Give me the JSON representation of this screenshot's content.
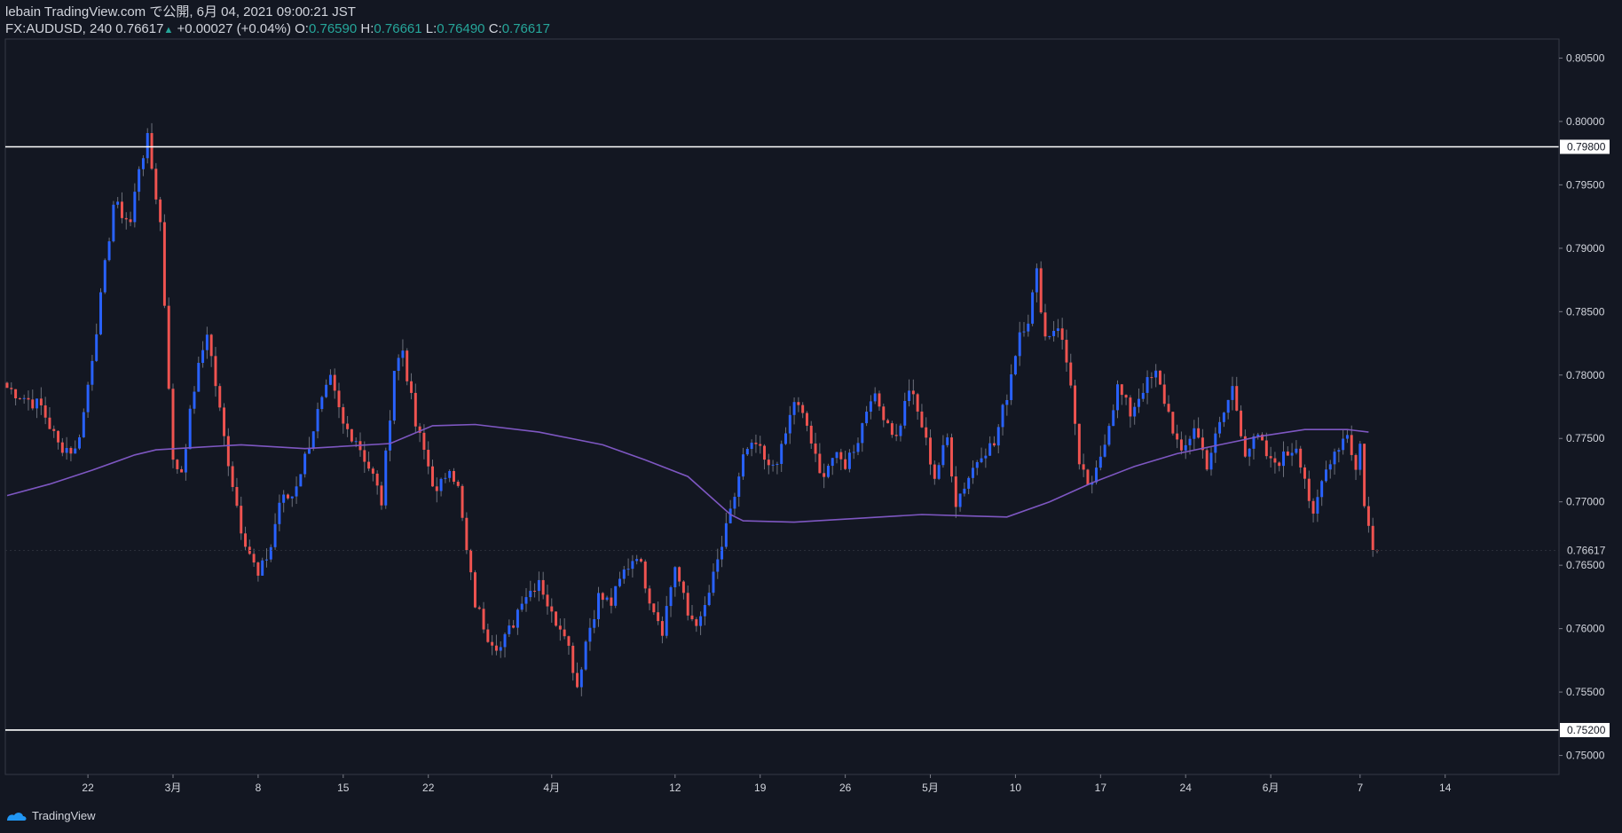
{
  "header": {
    "publisher": "lebain TradingView.com で公開, 6月 04, 2021 09:00:21 JST",
    "symbol": "FX:AUDUSD, 240",
    "last_price": "0.76617",
    "change": "+0.00027 (+0.04%)",
    "open_label": "O:",
    "open": "0.76590",
    "high_label": "H:",
    "high": "0.76661",
    "low_label": "L:",
    "low": "0.76490",
    "close_label": "C:",
    "close": "0.76617"
  },
  "footer": {
    "brand": "TradingView"
  },
  "colors": {
    "background": "#131722",
    "up": "#2962ff",
    "down": "#ef5350",
    "ma": "#7e57c2",
    "hline": "#ffffff",
    "text": "#d1d4dc",
    "accent": "#26a69a"
  },
  "chart_data": {
    "type": "candlestick",
    "symbol": "FX:AUDUSD",
    "timeframe": "240",
    "y_range": [
      0.7485,
      0.8065
    ],
    "y_ticks": [
      "0.80500",
      "0.80000",
      "0.79500",
      "0.79000",
      "0.78500",
      "0.78000",
      "0.77500",
      "0.77000",
      "0.76500",
      "0.76000",
      "0.75500",
      "0.75000"
    ],
    "x_ticks": [
      "22",
      "3月",
      "8",
      "15",
      "22",
      "4月",
      "12",
      "19",
      "26",
      "5月",
      "10",
      "17",
      "24",
      "6月",
      "7",
      "14"
    ],
    "horizontal_levels": [
      "0.79800",
      "0.75200"
    ],
    "current_price_label": "0.76617",
    "moving_average": "purple line",
    "close_path": [
      [
        0,
        0.779
      ],
      [
        8,
        0.7775
      ],
      [
        12,
        0.7745
      ],
      [
        16,
        0.774
      ],
      [
        18,
        0.777
      ],
      [
        22,
        0.786
      ],
      [
        25,
        0.7935
      ],
      [
        29,
        0.792
      ],
      [
        31,
        0.7965
      ],
      [
        33,
        0.7985
      ],
      [
        36,
        0.792
      ],
      [
        39,
        0.773
      ],
      [
        41,
        0.7725
      ],
      [
        44,
        0.779
      ],
      [
        47,
        0.7835
      ],
      [
        51,
        0.775
      ],
      [
        55,
        0.768
      ],
      [
        59,
        0.764
      ],
      [
        62,
        0.7665
      ],
      [
        64,
        0.77
      ],
      [
        67,
        0.7705
      ],
      [
        70,
        0.7735
      ],
      [
        73,
        0.777
      ],
      [
        76,
        0.7795
      ],
      [
        79,
        0.776
      ],
      [
        82,
        0.775
      ],
      [
        86,
        0.772
      ],
      [
        88,
        0.77
      ],
      [
        91,
        0.7805
      ],
      [
        93,
        0.782
      ],
      [
        96,
        0.776
      ],
      [
        98,
        0.774
      ],
      [
        101,
        0.7705
      ],
      [
        104,
        0.773
      ],
      [
        106,
        0.771
      ],
      [
        108,
        0.766
      ],
      [
        110,
        0.762
      ],
      [
        113,
        0.7595
      ],
      [
        116,
        0.7585
      ],
      [
        119,
        0.7605
      ],
      [
        121,
        0.7625
      ],
      [
        123,
        0.763
      ],
      [
        125,
        0.764
      ],
      [
        128,
        0.761
      ],
      [
        131,
        0.76
      ],
      [
        134,
        0.7555
      ],
      [
        136,
        0.759
      ],
      [
        139,
        0.7625
      ],
      [
        142,
        0.762
      ],
      [
        145,
        0.7645
      ],
      [
        148,
        0.766
      ],
      [
        151,
        0.7625
      ],
      [
        154,
        0.76
      ],
      [
        157,
        0.765
      ],
      [
        160,
        0.761
      ],
      [
        163,
        0.7605
      ],
      [
        166,
        0.764
      ],
      [
        170,
        0.769
      ],
      [
        173,
        0.7735
      ],
      [
        176,
        0.7745
      ],
      [
        179,
        0.7725
      ],
      [
        182,
        0.774
      ],
      [
        185,
        0.778
      ],
      [
        188,
        0.776
      ],
      [
        191,
        0.772
      ],
      [
        194,
        0.7735
      ],
      [
        197,
        0.773
      ],
      [
        200,
        0.775
      ],
      [
        203,
        0.7785
      ],
      [
        206,
        0.777
      ],
      [
        209,
        0.775
      ],
      [
        212,
        0.779
      ],
      [
        215,
        0.776
      ],
      [
        218,
        0.772
      ],
      [
        221,
        0.775
      ],
      [
        223,
        0.77
      ],
      [
        226,
        0.772
      ],
      [
        229,
        0.774
      ],
      [
        232,
        0.7745
      ],
      [
        235,
        0.7785
      ],
      [
        238,
        0.7835
      ],
      [
        240,
        0.7845
      ],
      [
        242,
        0.788
      ],
      [
        244,
        0.783
      ],
      [
        247,
        0.784
      ],
      [
        250,
        0.7795
      ],
      [
        252,
        0.7725
      ],
      [
        255,
        0.771
      ],
      [
        258,
        0.775
      ],
      [
        261,
        0.779
      ],
      [
        264,
        0.777
      ],
      [
        267,
        0.779
      ],
      [
        270,
        0.78
      ],
      [
        273,
        0.777
      ],
      [
        276,
        0.7735
      ],
      [
        279,
        0.776
      ],
      [
        282,
        0.773
      ],
      [
        285,
        0.776
      ],
      [
        288,
        0.779
      ],
      [
        291,
        0.774
      ],
      [
        294,
        0.775
      ],
      [
        297,
        0.773
      ],
      [
        300,
        0.7735
      ],
      [
        303,
        0.7745
      ],
      [
        305,
        0.772
      ],
      [
        307,
        0.7685
      ],
      [
        309,
        0.7715
      ],
      [
        311,
        0.7735
      ],
      [
        313,
        0.7745
      ],
      [
        315,
        0.7755
      ],
      [
        317,
        0.7725
      ],
      [
        318,
        0.7745
      ],
      [
        319,
        0.77
      ],
      [
        321,
        0.766
      ],
      [
        322,
        0.7662
      ]
    ],
    "ma_path": [
      [
        0,
        0.7705
      ],
      [
        10,
        0.7714
      ],
      [
        20,
        0.7725
      ],
      [
        30,
        0.7737
      ],
      [
        35,
        0.7741
      ],
      [
        45,
        0.7743
      ],
      [
        55,
        0.7745
      ],
      [
        70,
        0.7742
      ],
      [
        90,
        0.7746
      ],
      [
        100,
        0.776
      ],
      [
        110,
        0.7761
      ],
      [
        125,
        0.7755
      ],
      [
        140,
        0.7745
      ],
      [
        150,
        0.7733
      ],
      [
        160,
        0.772
      ],
      [
        170,
        0.769
      ],
      [
        173,
        0.7685
      ],
      [
        185,
        0.7684
      ],
      [
        200,
        0.7687
      ],
      [
        215,
        0.769
      ],
      [
        225,
        0.7689
      ],
      [
        235,
        0.7688
      ],
      [
        245,
        0.77
      ],
      [
        255,
        0.7715
      ],
      [
        265,
        0.7728
      ],
      [
        275,
        0.7738
      ],
      [
        285,
        0.7745
      ],
      [
        295,
        0.7752
      ],
      [
        305,
        0.7757
      ],
      [
        315,
        0.7757
      ],
      [
        320,
        0.7755
      ]
    ]
  }
}
